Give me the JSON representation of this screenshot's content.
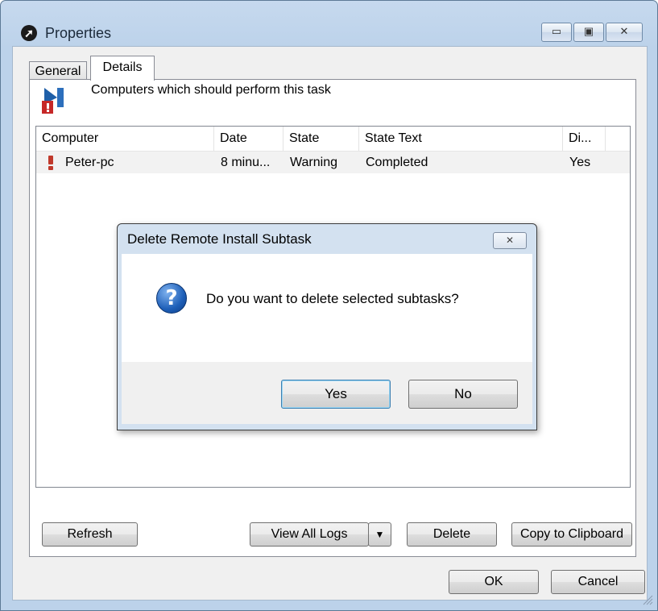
{
  "window": {
    "title": "Properties",
    "icon": "arrow-circle-icon"
  },
  "caption_buttons": {
    "minimize": "▭",
    "maximize": "▣",
    "close": "✕"
  },
  "tabs": [
    {
      "label": "General"
    },
    {
      "label": "Details"
    }
  ],
  "panel": {
    "description": "Computers which should perform this task"
  },
  "list": {
    "columns": [
      "Computer",
      "Date",
      "State",
      "State Text",
      "Di..."
    ],
    "rows": [
      {
        "computer": "Peter-pc",
        "date": "8 minu...",
        "state": "Warning",
        "state_text": "Completed",
        "di": "Yes"
      }
    ]
  },
  "buttons": {
    "refresh": "Refresh",
    "view_all_logs": "View All Logs",
    "dropdown": "▼",
    "delete": "Delete",
    "copy": "Copy to Clipboard",
    "ok": "OK",
    "cancel": "Cancel"
  },
  "dialog": {
    "title": "Delete Remote Install Subtask",
    "close": "✕",
    "icon": "question-icon",
    "icon_glyph": "?",
    "message": "Do you want to delete selected subtasks?",
    "yes": "Yes",
    "no": "No"
  },
  "colors": {
    "window_frame": "#bcd2ea",
    "row_warning": "#c0392b",
    "accent": "#1e5fb8"
  }
}
